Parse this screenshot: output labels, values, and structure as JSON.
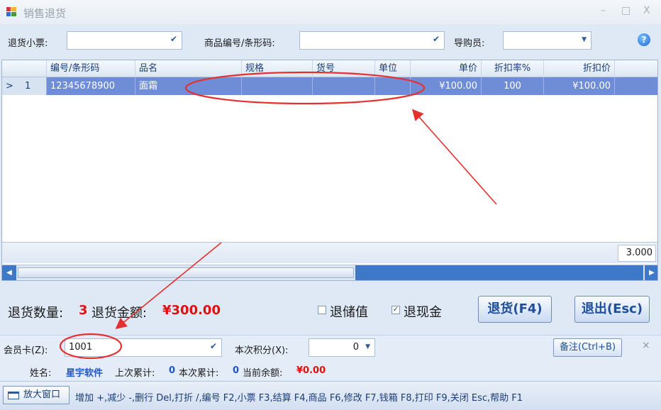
{
  "window": {
    "title": "销售退货",
    "controls": [
      "–",
      "□",
      "X"
    ]
  },
  "filters": {
    "receipt_label": "退货小票:",
    "receipt_value": "",
    "product_label": "商品编号/条形码:",
    "product_value": "",
    "guide_label": "导购员:",
    "guide_value": ""
  },
  "grid": {
    "columns": [
      "编号/条形码",
      "品名",
      "规格",
      "货号",
      "单位",
      "单价",
      "折扣率%",
      "折扣价"
    ],
    "rows": [
      {
        "indicator": ">",
        "index": "1",
        "code": "12345678900",
        "name": "面霜",
        "spec": "",
        "item_no": "",
        "unit": "",
        "price": "¥100.00",
        "discount_rate": "100",
        "discount_price": "¥100.00"
      }
    ],
    "footer_total": "3.000"
  },
  "summary": {
    "qty_label": "退货数量:",
    "qty_value": "3",
    "amount_label": "退货金额:",
    "amount_value": "¥300.00",
    "stored_value_label": "退储值",
    "stored_value_checked": false,
    "cash_label": "退现金",
    "cash_checked": true,
    "return_button": "退货(F4)",
    "exit_button": "退出(Esc)"
  },
  "member": {
    "card_label": "会员卡(Z):",
    "card_value": "1001",
    "points_label": "本次积分(X):",
    "points_value": "0",
    "remark_button": "备注(Ctrl+B)",
    "close_glyph": "×",
    "name_label": "姓名:",
    "name_value": "星宇软件",
    "last_total_label": "上次累计:",
    "last_total_value": "0",
    "this_total_label": "本次累计:",
    "this_total_value": "0",
    "balance_label": "当前余额:",
    "balance_value": "¥0.00"
  },
  "statusbar": {
    "zoom_button": "放大窗口",
    "shortcuts": "增加 +,减少 -,删行 Del,打折 /,编号 F2,小票 F3,结算 F4,商品 F6,修改 F7,钱箱 F8,打印 F9,关闭 Esc,帮助 F1"
  },
  "colors": {
    "selected_row": "#6f8dd6",
    "annotation_red": "#e53030",
    "accent_blue": "#1f55c9"
  }
}
